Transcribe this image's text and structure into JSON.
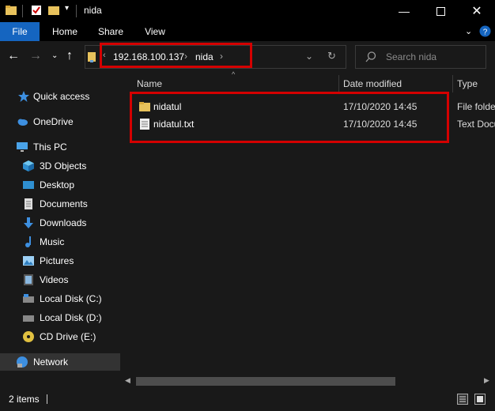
{
  "window": {
    "title": "nida"
  },
  "ribbon": {
    "tabs": [
      "File",
      "Home",
      "Share",
      "View"
    ]
  },
  "address": {
    "crumbs": [
      "192.168.100.137",
      "nida"
    ]
  },
  "search": {
    "placeholder": "Search nida"
  },
  "columns": {
    "name": "Name",
    "date": "Date modified",
    "type": "Type"
  },
  "nav": {
    "items": [
      {
        "label": "Quick access",
        "icon": "star-icon"
      },
      {
        "label": "OneDrive",
        "icon": "cloud-icon"
      },
      {
        "label": "This PC",
        "icon": "monitor-icon"
      },
      {
        "label": "3D Objects",
        "icon": "cube-icon"
      },
      {
        "label": "Desktop",
        "icon": "desktop-icon"
      },
      {
        "label": "Documents",
        "icon": "documents-icon"
      },
      {
        "label": "Downloads",
        "icon": "download-icon"
      },
      {
        "label": "Music",
        "icon": "music-icon"
      },
      {
        "label": "Pictures",
        "icon": "pictures-icon"
      },
      {
        "label": "Videos",
        "icon": "videos-icon"
      },
      {
        "label": "Local Disk (C:)",
        "icon": "disk-icon"
      },
      {
        "label": "Local Disk (D:)",
        "icon": "disk-icon"
      },
      {
        "label": "CD Drive (E:)",
        "icon": "cd-icon"
      },
      {
        "label": "Network",
        "icon": "network-icon"
      }
    ]
  },
  "files": [
    {
      "name": "nidatul",
      "date": "17/10/2020 14:45",
      "type": "File folder",
      "icon": "folder-icon"
    },
    {
      "name": "nidatul.txt",
      "date": "17/10/2020 14:45",
      "type": "Text Docu",
      "icon": "text-file-icon"
    }
  ],
  "status": {
    "count": "2 items"
  },
  "colors": {
    "accent": "#1565c0",
    "highlight": "#d40000"
  }
}
